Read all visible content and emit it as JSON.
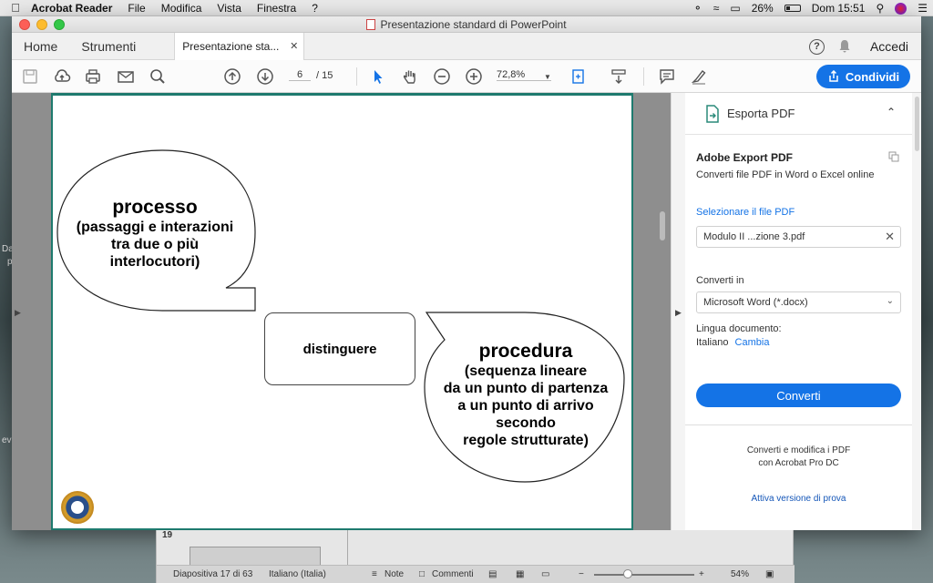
{
  "menubar": {
    "app": "Acrobat Reader",
    "items": [
      "File",
      "Modifica",
      "Vista",
      "Finestra",
      "?"
    ],
    "battery": "26%",
    "clock": "Dom 15:51"
  },
  "window": {
    "title": "Presentazione standard di PowerPoint"
  },
  "tabs": {
    "home": "Home",
    "tools": "Strumenti",
    "doc_tab": "Presentazione sta...",
    "login": "Accedi"
  },
  "toolbar": {
    "page_current": "6",
    "page_total": "/ 15",
    "zoom": "72,8%",
    "share": "Condividi"
  },
  "slide": {
    "bubble1_title": "processo",
    "bubble1_lines": [
      "(passaggi e interazioni",
      "tra due o più",
      "interlocutori)"
    ],
    "center": "distinguere",
    "bubble2_title": "procedura",
    "bubble2_lines": [
      "(sequenza lineare",
      "da un punto di partenza",
      "a un punto di arrivo",
      "secondo",
      "regole strutturate)"
    ]
  },
  "export_panel": {
    "header": "Esporta PDF",
    "title": "Adobe Export PDF",
    "subtitle": "Converti file PDF in Word o Excel online",
    "select_label": "Selezionare il file PDF",
    "file_name": "Modulo II ...zione 3.pdf",
    "convert_to_label": "Converti in",
    "format": "Microsoft Word (*.docx)",
    "language_label": "Lingua documento:",
    "language": "Italiano",
    "change": "Cambia",
    "convert_button": "Converti",
    "promo_line1": "Converti e modifica i PDF",
    "promo_line2": "con Acrobat Pro DC",
    "trial": "Attiva versione di prova"
  },
  "background_window": {
    "slide_number": "19",
    "status_slide": "Diapositiva 17 di 63",
    "status_lang": "Italiano (Italia)",
    "notes": "Note",
    "comments": "Commenti",
    "zoom": "54%"
  },
  "desktop_text": {
    "left1": "Da",
    "left2": "p",
    "left3": "evi"
  },
  "colors": {
    "accent": "#1473e6",
    "slide_border": "#1e7a6e"
  }
}
